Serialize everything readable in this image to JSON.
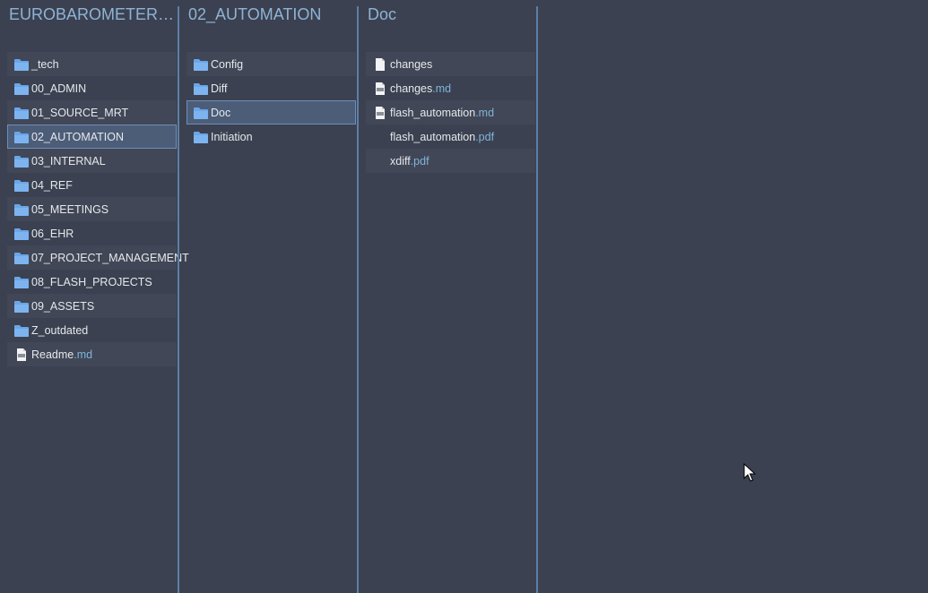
{
  "columns": [
    {
      "title": "EUROBAROMETER_FL...",
      "items": [
        {
          "name": "_tech",
          "ext": "",
          "type": "folder"
        },
        {
          "name": "00_ADMIN",
          "ext": "",
          "type": "folder"
        },
        {
          "name": "01_SOURCE_MRT",
          "ext": "",
          "type": "folder"
        },
        {
          "name": "02_AUTOMATION",
          "ext": "",
          "type": "folder",
          "selected": true
        },
        {
          "name": "03_INTERNAL",
          "ext": "",
          "type": "folder"
        },
        {
          "name": "04_REF",
          "ext": "",
          "type": "folder"
        },
        {
          "name": "05_MEETINGS",
          "ext": "",
          "type": "folder"
        },
        {
          "name": "06_EHR",
          "ext": "",
          "type": "folder"
        },
        {
          "name": "07_PROJECT_MANAGEMENT",
          "ext": "",
          "type": "folder"
        },
        {
          "name": "08_FLASH_PROJECTS",
          "ext": "",
          "type": "folder"
        },
        {
          "name": "09_ASSETS",
          "ext": "",
          "type": "folder"
        },
        {
          "name": "Z_outdated",
          "ext": "",
          "type": "folder"
        },
        {
          "name": "Readme",
          "ext": ".md",
          "type": "md"
        }
      ]
    },
    {
      "title": "02_AUTOMATION",
      "items": [
        {
          "name": "Config",
          "ext": "",
          "type": "folder"
        },
        {
          "name": "Diff",
          "ext": "",
          "type": "folder"
        },
        {
          "name": "Doc",
          "ext": "",
          "type": "folder",
          "selected": true
        },
        {
          "name": "Initiation",
          "ext": "",
          "type": "folder"
        }
      ]
    },
    {
      "title": "Doc",
      "items": [
        {
          "name": "changes",
          "ext": "",
          "type": "file"
        },
        {
          "name": "changes",
          "ext": ".md",
          "type": "md"
        },
        {
          "name": "flash_automation",
          "ext": ".md",
          "type": "md"
        },
        {
          "name": "flash_automation",
          "ext": ".pdf",
          "type": "pdf"
        },
        {
          "name": "xdiff",
          "ext": ".pdf",
          "type": "pdf"
        }
      ]
    },
    {
      "title": "",
      "items": []
    }
  ]
}
